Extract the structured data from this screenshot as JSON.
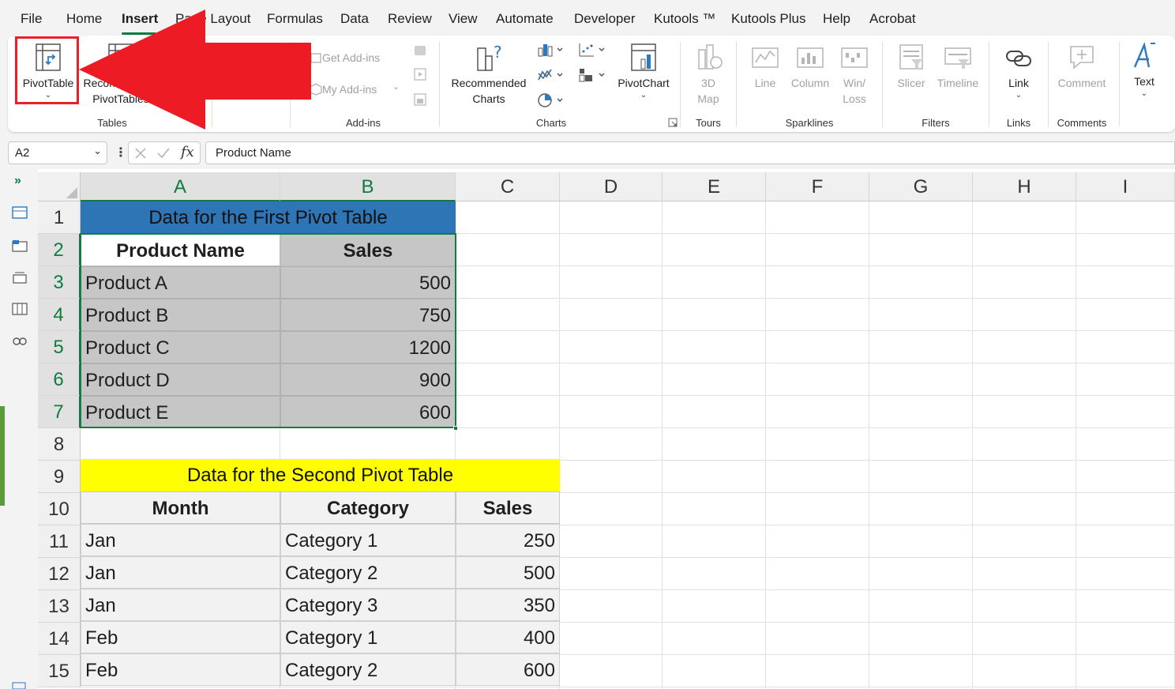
{
  "menu": {
    "items": [
      "File",
      "Home",
      "Insert",
      "Page Layout",
      "Formulas",
      "Data",
      "Review",
      "View",
      "Automate",
      "Developer",
      "Kutools ™",
      "Kutools Plus",
      "Help",
      "Acrobat"
    ],
    "active": "Insert"
  },
  "ribbon": {
    "pivot_table": "PivotTable",
    "recommended_pivot_1": "Recommended",
    "recommended_pivot_2": "PivotTables",
    "tables_group": "Tables",
    "get_addins": "Get Add-ins",
    "my_addins": "My Add-ins",
    "addins_group": "Add-ins",
    "recommended_charts_1": "Recommended",
    "recommended_charts_2": "Charts",
    "pivot_chart": "PivotChart",
    "charts_group": "Charts",
    "map3d_1": "3D",
    "map3d_2": "Map",
    "tours_group": "Tours",
    "line": "Line",
    "column": "Column",
    "winloss_1": "Win/",
    "winloss_2": "Loss",
    "sparklines_group": "Sparklines",
    "slicer": "Slicer",
    "timeline": "Timeline",
    "filters_group": "Filters",
    "link": "Link",
    "links_group": "Links",
    "comment": "Comment",
    "comments_group": "Comments",
    "text": "Text"
  },
  "formula_bar": {
    "name_box": "A2",
    "formula": "Product Name"
  },
  "sheet": {
    "columns": [
      "A",
      "B",
      "C",
      "D",
      "E",
      "F",
      "G",
      "H",
      "I"
    ],
    "rows": [
      "1",
      "2",
      "3",
      "4",
      "5",
      "6",
      "7",
      "8",
      "9",
      "10",
      "11",
      "12",
      "13",
      "14",
      "15"
    ],
    "table1": {
      "title": "Data for the First Pivot Table",
      "headers": [
        "Product Name",
        "Sales"
      ],
      "rows": [
        [
          "Product A",
          "500"
        ],
        [
          "Product B",
          "750"
        ],
        [
          "Product C",
          "1200"
        ],
        [
          "Product D",
          "900"
        ],
        [
          "Product E",
          "600"
        ]
      ]
    },
    "table2": {
      "title": "Data for the Second Pivot Table",
      "headers": [
        "Month",
        "Category",
        "Sales"
      ],
      "rows": [
        [
          "Jan",
          "Category 1",
          "250"
        ],
        [
          "Jan",
          "Category 2",
          "500"
        ],
        [
          "Jan",
          "Category 3",
          "350"
        ],
        [
          "Feb",
          "Category 1",
          "400"
        ],
        [
          "Feb",
          "Category 2",
          "600"
        ]
      ]
    }
  },
  "colors": {
    "accent_green": "#107c41",
    "title1_fill": "#2e75b6",
    "title2_fill": "#ffff00",
    "selection_fill": "#c6c6c6",
    "table2_fill": "#f2f2f2",
    "highlight_red": "#e8202a"
  }
}
